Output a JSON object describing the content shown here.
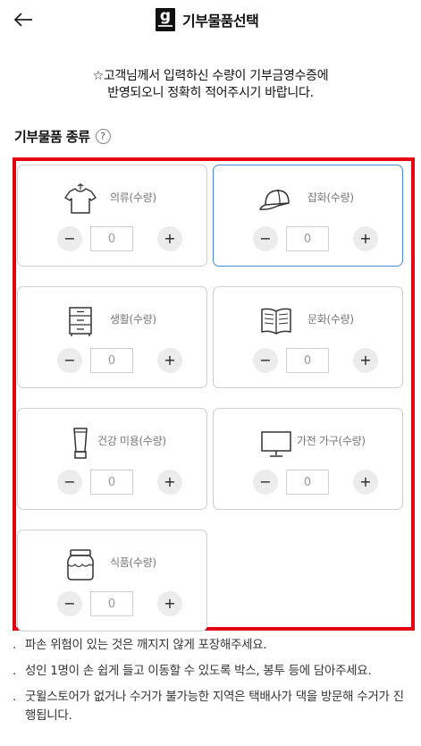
{
  "header": {
    "back_icon": "arrow-left-icon",
    "logo_icon": "goodwill-logo-icon",
    "title": "기부물품선택"
  },
  "notice": {
    "line1": "☆고객님께서 입력하신 수량이 기부금영수증에",
    "line2": "반영되오니 정확히 적어주시기 바랍니다."
  },
  "section": {
    "title": "기부물품 종류",
    "help_label": "?"
  },
  "highlight_color": "#e50012",
  "selected_border_color": "#4a8bd6",
  "categories": [
    {
      "id": "clothing",
      "label": "의류(수량)",
      "icon": "tshirt-icon",
      "quantity": "0",
      "selected": false
    },
    {
      "id": "goods",
      "label": "잡화(수량)",
      "icon": "cap-icon",
      "quantity": "0",
      "selected": true
    },
    {
      "id": "household",
      "label": "생활(수량)",
      "icon": "drawer-cabinet-icon",
      "quantity": "0",
      "selected": false
    },
    {
      "id": "culture",
      "label": "문화(수량)",
      "icon": "book-icon",
      "quantity": "0",
      "selected": false
    },
    {
      "id": "health-beauty",
      "label": "건강 미용(수량)",
      "icon": "cosmetic-tube-icon",
      "quantity": "0",
      "selected": false
    },
    {
      "id": "appliance-furniture",
      "label": "가전 가구(수량)",
      "icon": "monitor-icon",
      "quantity": "0",
      "selected": false
    },
    {
      "id": "food",
      "label": "식품(수량)",
      "icon": "jar-icon",
      "quantity": "0",
      "selected": false
    }
  ],
  "stepper": {
    "minus": "−",
    "plus": "+"
  },
  "notes": [
    "파손 위험이 있는 것은 깨지지 않게 포장해주세요.",
    "성인 1명이 손 쉽게 들고 이동할 수 있도록 박스, 봉투 등에 담아주세요.",
    "굿윌스토어가 없거나 수거가 불가능한 지역은 택배사가 댁을 방문해 수거가 진행됩니다."
  ],
  "note_bullet": "."
}
